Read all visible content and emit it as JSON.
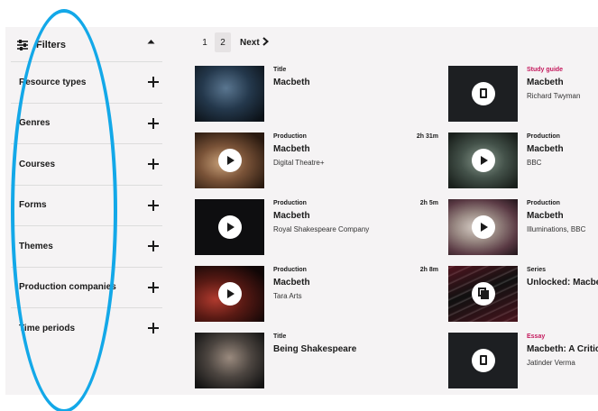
{
  "sidebar": {
    "title": "Filters",
    "items": [
      {
        "label": "Resource types"
      },
      {
        "label": "Genres"
      },
      {
        "label": "Courses"
      },
      {
        "label": "Forms"
      },
      {
        "label": "Themes"
      },
      {
        "label": "Production companies"
      },
      {
        "label": "Time periods"
      }
    ]
  },
  "pagination": {
    "pages": [
      "1",
      "2"
    ],
    "current": "2",
    "next_label": "Next"
  },
  "results": {
    "left": [
      {
        "type": "Title",
        "title": "Macbeth",
        "subtitle": "",
        "duration": "",
        "badge": "none",
        "thumb": "dark"
      },
      {
        "type": "Production",
        "title": "Macbeth",
        "subtitle": "Digital Theatre+",
        "duration": "2h 31m",
        "badge": "play",
        "thumb": "stage"
      },
      {
        "type": "Production",
        "title": "Macbeth",
        "subtitle": "Royal Shakespeare Company",
        "duration": "2h 5m",
        "badge": "play",
        "thumb": "black"
      },
      {
        "type": "Production",
        "title": "Macbeth",
        "subtitle": "Tara Arts",
        "duration": "2h 8m",
        "badge": "play",
        "thumb": "red"
      },
      {
        "type": "Title",
        "title": "Being Shakespeare",
        "subtitle": "",
        "duration": "",
        "badge": "none",
        "thumb": "portrait"
      }
    ],
    "right": [
      {
        "type": "Study guide",
        "type_color": "pink",
        "title": "Macbeth",
        "subtitle": "Richard Twyman",
        "badge": "document",
        "thumb": "black"
      },
      {
        "type": "Production",
        "type_color": "dark",
        "title": "Macbeth",
        "subtitle": "BBC",
        "badge": "play",
        "thumb": "teal"
      },
      {
        "type": "Production",
        "type_color": "dark",
        "title": "Macbeth",
        "subtitle": "Illuminations, BBC",
        "badge": "play",
        "thumb": "crowd"
      },
      {
        "type": "Series",
        "type_color": "dark",
        "title": "Unlocked: Macbeth",
        "subtitle": "",
        "badge": "collection",
        "thumb": "typography"
      },
      {
        "type": "Essay",
        "type_color": "pink",
        "title": "Macbeth: A Critic",
        "subtitle": "Jatinder Verma",
        "badge": "document",
        "thumb": "black"
      }
    ]
  },
  "colors": {
    "accent_pink": "#c4185c",
    "annotation_blue": "#13a8e8",
    "panel_bg": "#f5f3f4"
  },
  "icons": {
    "filters": "sliders-icon",
    "collapse": "chevron-up-icon",
    "expand": "plus-icon",
    "next": "chevron-right-icon"
  }
}
